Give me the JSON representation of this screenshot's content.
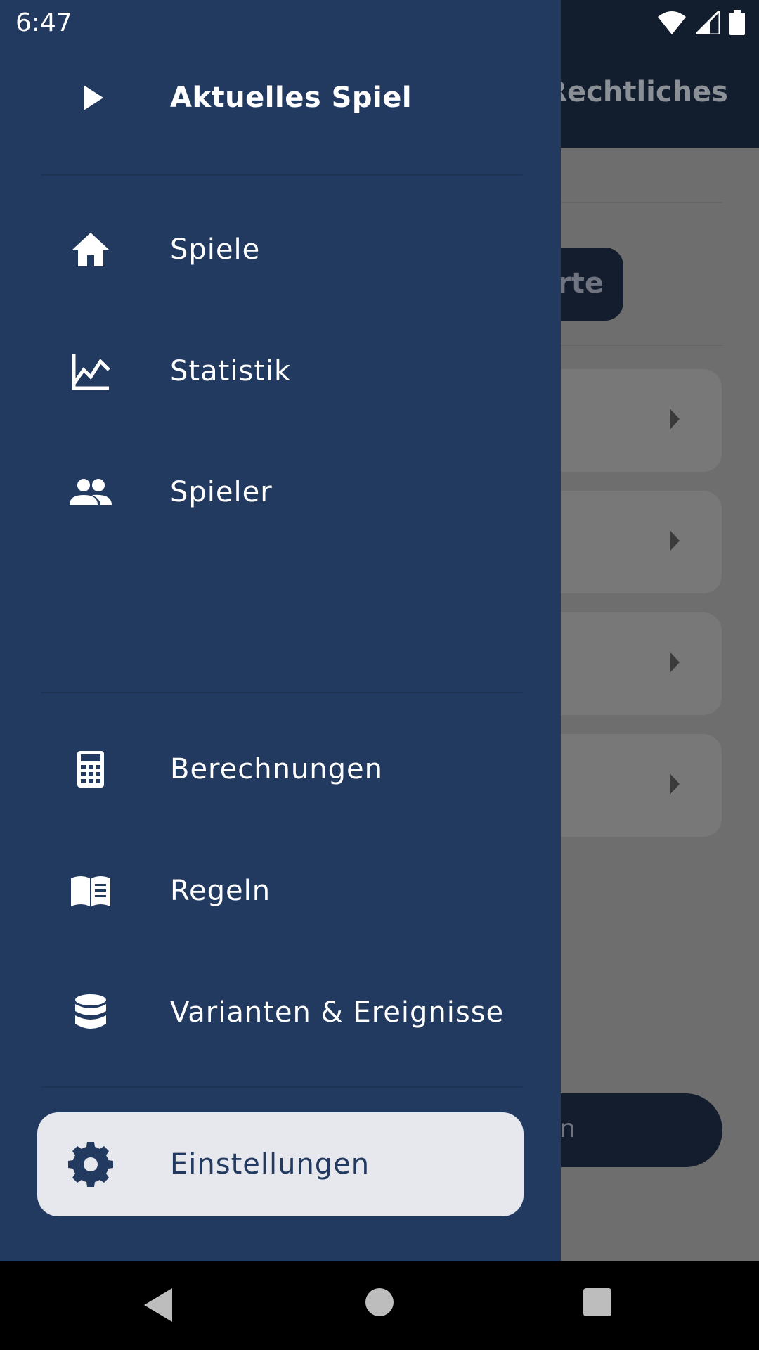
{
  "status_bar": {
    "time": "6:47"
  },
  "background": {
    "tab_label": "Rechtliches",
    "chip_text": "erte",
    "button_text": "n"
  },
  "drawer": {
    "items": [
      {
        "label": "Aktuelles Spiel",
        "icon": "play-icon",
        "bold": true
      },
      {
        "label": "Spiele",
        "icon": "home-icon"
      },
      {
        "label": "Statistik",
        "icon": "chart-icon"
      },
      {
        "label": "Spieler",
        "icon": "people-icon"
      },
      {
        "label": "Berechnungen",
        "icon": "calculator-icon"
      },
      {
        "label": "Regeln",
        "icon": "book-icon"
      },
      {
        "label": "Varianten & Ereignisse",
        "icon": "database-icon"
      },
      {
        "label": "Einstellungen",
        "icon": "gear-icon",
        "selected": true
      }
    ]
  },
  "colors": {
    "drawer_bg": "#233a60",
    "selected_bg": "#e6e8ee",
    "top_bar": "#121d2e"
  }
}
